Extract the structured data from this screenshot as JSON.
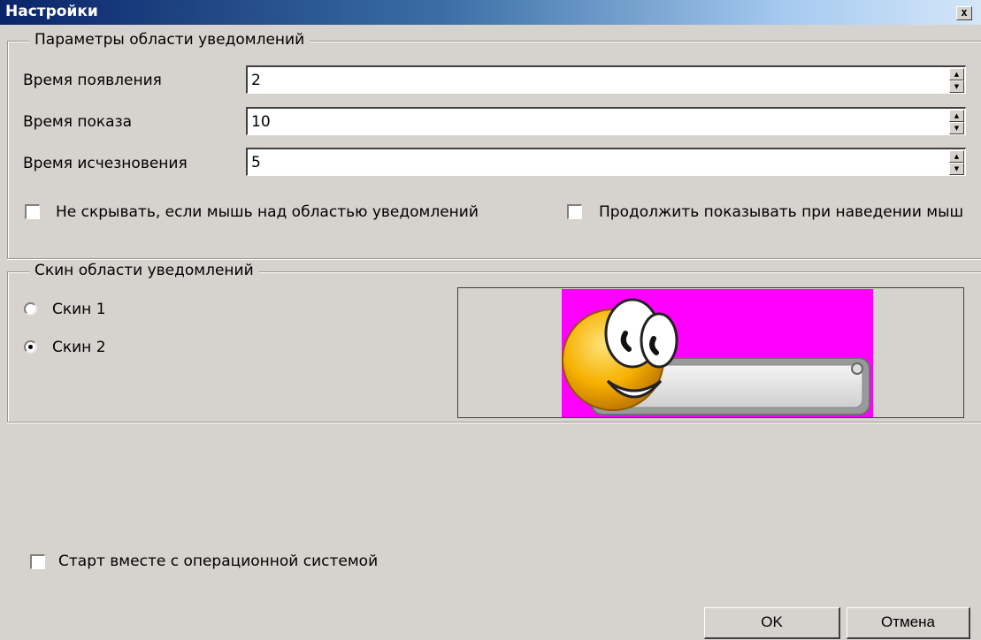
{
  "window": {
    "title": "Настройки",
    "close_symbol": "x"
  },
  "notification_params": {
    "legend": "Параметры области уведомлений",
    "fields": [
      {
        "label": "Время появления",
        "value": "2"
      },
      {
        "label": "Время показа",
        "value": "10"
      },
      {
        "label": "Время исчезновения",
        "value": "5"
      }
    ],
    "checkbox_hide": {
      "label": "Не скрывать, если мышь над областью уведомлений",
      "checked": false
    },
    "checkbox_continue": {
      "label": "Продолжить показывать при наведении мыш",
      "checked": false
    }
  },
  "skin": {
    "legend": "Скин области уведомлений",
    "options": [
      {
        "label": "Скин 1",
        "selected": false
      },
      {
        "label": "Скин 2",
        "selected": true
      }
    ],
    "preview_bg": "#ff00ff"
  },
  "startup": {
    "label": "Старт вместе с операционной системой",
    "checked": false
  },
  "buttons": {
    "ok": "OK",
    "cancel": "Отмена"
  },
  "icons": {
    "spin_up": "▲",
    "spin_down": "▼"
  }
}
